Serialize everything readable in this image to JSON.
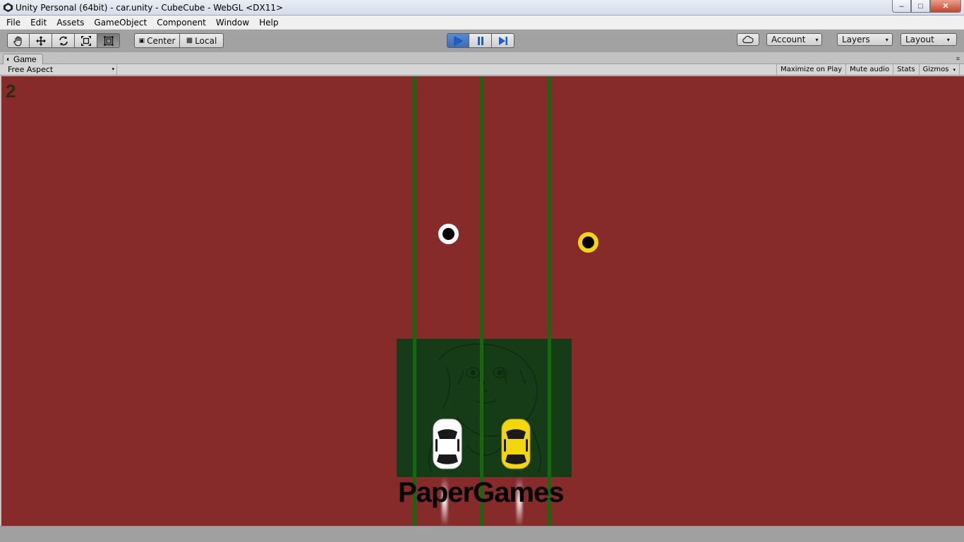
{
  "window": {
    "title": "Unity Personal (64bit) - car.unity - CubeCube - WebGL <DX11>",
    "controls": {
      "minimize": "–",
      "maximize": "□",
      "close": "✕"
    }
  },
  "menu": [
    "File",
    "Edit",
    "Assets",
    "GameObject",
    "Component",
    "Window",
    "Help"
  ],
  "toolbar": {
    "transform_tools": [
      "hand-icon",
      "move-icon",
      "rotate-icon",
      "scale-icon",
      "rect-icon"
    ],
    "pivot_label": "Center",
    "space_label": "Local",
    "playback": [
      "play-icon",
      "pause-icon",
      "step-icon"
    ],
    "account_label": "Account",
    "layers_label": "Layers",
    "layout_label": "Layout",
    "dropdown_glyph": "▾"
  },
  "tab": {
    "label": "Game"
  },
  "gameview": {
    "aspect": "Free Aspect",
    "buttons": [
      "Maximize on Play",
      "Mute audio",
      "Stats",
      "Gizmos"
    ]
  },
  "game": {
    "score": "2",
    "logo": "PaperGames",
    "colors": {
      "background": "#862a2a",
      "lane_line": "#146a0a",
      "logo_panel": "#163c17",
      "white_car": "#ffffff",
      "yellow_car": "#f3d70a"
    }
  }
}
